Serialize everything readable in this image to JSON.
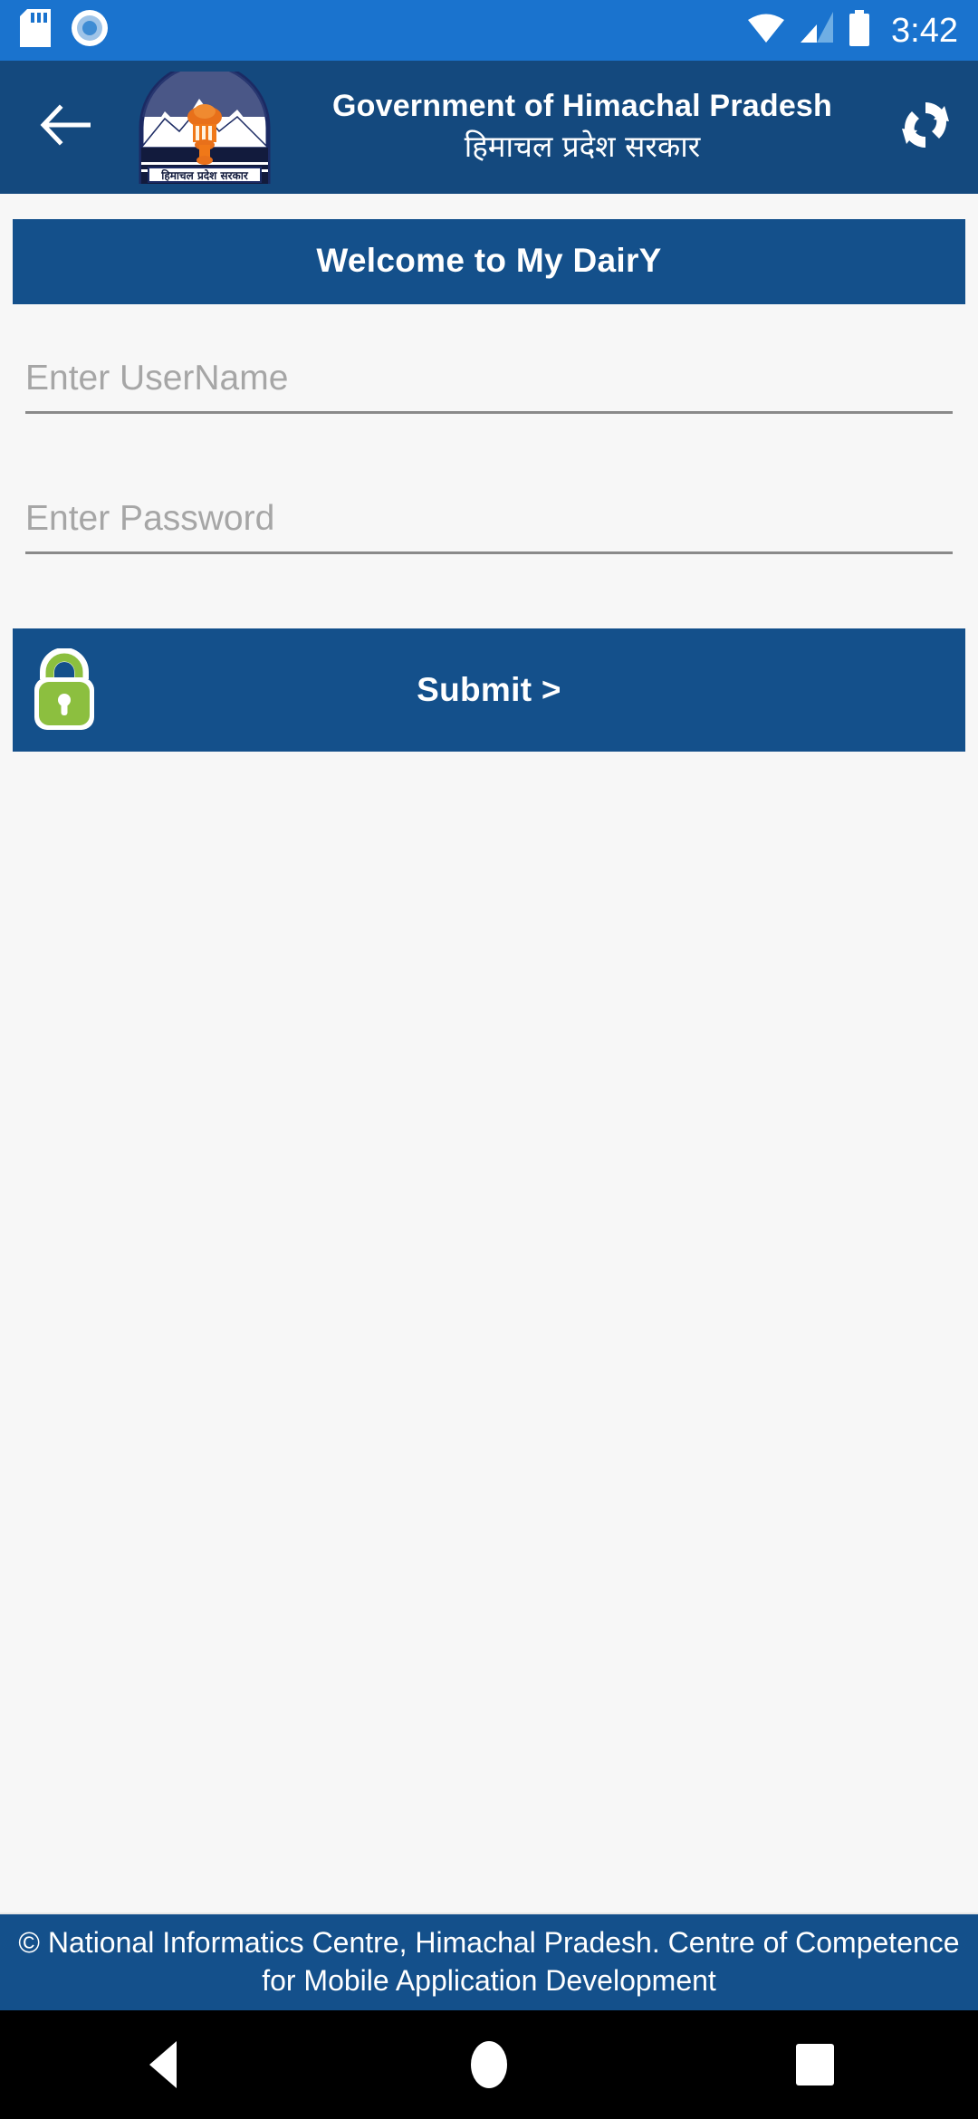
{
  "status_bar": {
    "icons_left": [
      "sd-card-icon",
      "record-circle-icon"
    ],
    "icons_right": [
      "wifi-icon",
      "cellular-signal-icon",
      "battery-icon"
    ],
    "time": "3:42",
    "background_color": "#1A73CE"
  },
  "header": {
    "back_icon": "back-arrow-icon",
    "emblem_alt": "himachal-pradesh-state-emblem",
    "emblem_caption": "हिमाचल प्रदेश सरकार",
    "title_en": "Government of Himachal Pradesh",
    "title_hi": "हिमाचल प्रदेश सरकार",
    "sync_icon": "sync-refresh-icon",
    "background_color": "#14497E"
  },
  "main": {
    "welcome_banner": "Welcome to My DairY",
    "banner_color": "#14508B",
    "username_field": {
      "placeholder": "Enter UserName",
      "value": ""
    },
    "password_field": {
      "placeholder": "Enter Password",
      "value": ""
    },
    "submit_button": {
      "label": "Submit >",
      "icon": "green-padlock-icon",
      "icon_color": "#8CBF3F",
      "background_color": "#14508B"
    }
  },
  "footer": {
    "text": "© National Informatics Centre, Himachal Pradesh. Centre of Competence for Mobile Application Development",
    "background_color": "#14508B"
  },
  "nav_bar": {
    "back_label": "back-triangle-icon",
    "home_label": "home-circle-icon",
    "recents_label": "recents-square-icon"
  }
}
